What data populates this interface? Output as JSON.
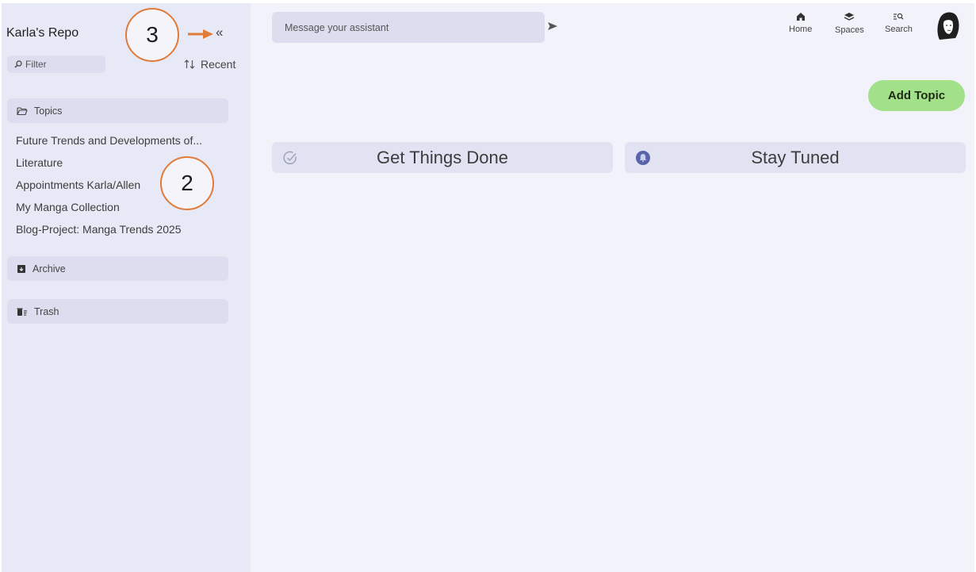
{
  "sidebar": {
    "repo_title": "Karla's Repo",
    "collapse_label": "«",
    "filter_label": "Filter",
    "sort_label": "Recent",
    "topics_header": "Topics",
    "topics": [
      "Future Trends and Developments of...",
      "Literature",
      "Appointments Karla/Allen",
      "My Manga Collection",
      "Blog-Project: Manga Trends 2025"
    ],
    "archive_label": "Archive",
    "trash_label": "Trash"
  },
  "annotations": {
    "callout_3": "3",
    "callout_2": "2",
    "color": "#e07b39"
  },
  "header": {
    "message_placeholder": "Message your assistant",
    "nav": {
      "home": "Home",
      "spaces": "Spaces",
      "search": "Search"
    }
  },
  "main": {
    "add_topic_label": "Add Topic",
    "cards": {
      "get_things_done": "Get Things Done",
      "stay_tuned": "Stay Tuned"
    }
  },
  "colors": {
    "sidebar_bg": "#e8e9f6",
    "main_bg": "#f1f2fa",
    "accent_green": "#a3e08a",
    "bell_blue": "#5a63a8"
  }
}
